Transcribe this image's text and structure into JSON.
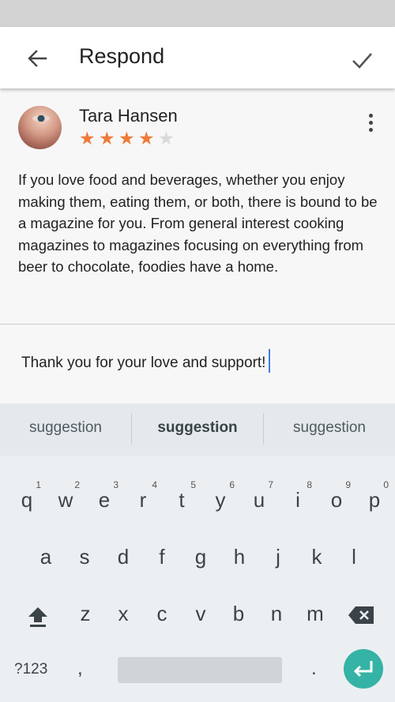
{
  "app_bar": {
    "title": "Respond",
    "back_icon": "arrow-left-icon",
    "done_icon": "checkmark-icon"
  },
  "review": {
    "reviewer_name": "Tara Hansen",
    "rating": 4,
    "rating_max": 5,
    "star_color": "#f07a3a",
    "text": "If you love food and beverages, whether you enjoy making them, eating them, or both, there is bound to be a magazine for you. From general interest cooking magazines to magazines focusing on everything from beer to chocolate, foodies have a home."
  },
  "reply": {
    "value": "Thank you for your love and support!"
  },
  "keyboard": {
    "suggestions": [
      "suggestion",
      "suggestion",
      "suggestion"
    ],
    "row1": [
      "q",
      "w",
      "e",
      "r",
      "t",
      "y",
      "u",
      "i",
      "o",
      "p"
    ],
    "row1_hints": [
      "1",
      "2",
      "3",
      "4",
      "5",
      "6",
      "7",
      "8",
      "9",
      "0"
    ],
    "row2": [
      "a",
      "s",
      "d",
      "f",
      "g",
      "h",
      "j",
      "k",
      "l"
    ],
    "row3": [
      "z",
      "x",
      "c",
      "v",
      "b",
      "n",
      "m"
    ],
    "symbols_label": "?123",
    "comma": ",",
    "period": ".",
    "enter_color": "#35b3a6"
  }
}
